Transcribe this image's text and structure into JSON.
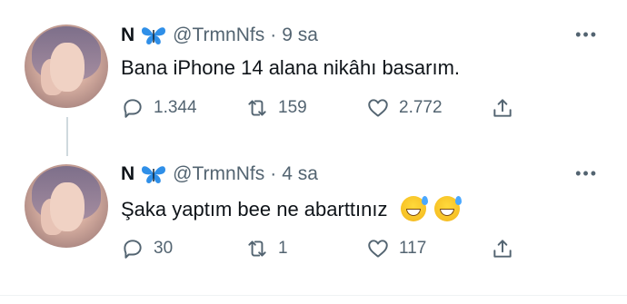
{
  "tweets": [
    {
      "name": "N",
      "name_emoji": "blue-butterfly",
      "handle": "@TrmnNfs",
      "separator": "·",
      "time": "9 sa",
      "text": "Bana iPhone 14 alana nikâhı basarım.",
      "replies": "1.344",
      "retweets": "159",
      "likes": "2.772"
    },
    {
      "name": "N",
      "name_emoji": "blue-butterfly",
      "handle": "@TrmnNfs",
      "separator": "·",
      "time": "4 sa",
      "text": "Şaka yaptım bee ne abarttınız",
      "text_emojis": [
        "grinning-face-with-sweat",
        "grinning-face-with-sweat"
      ],
      "replies": "30",
      "retweets": "1",
      "likes": "117"
    }
  ],
  "icons": {
    "reply": "reply-icon",
    "retweet": "retweet-icon",
    "like": "heart-icon",
    "share": "share-icon",
    "more": "more-icon"
  },
  "colors": {
    "text": "#0f1419",
    "secondary": "#536471",
    "thread_line": "#cfd9de"
  }
}
